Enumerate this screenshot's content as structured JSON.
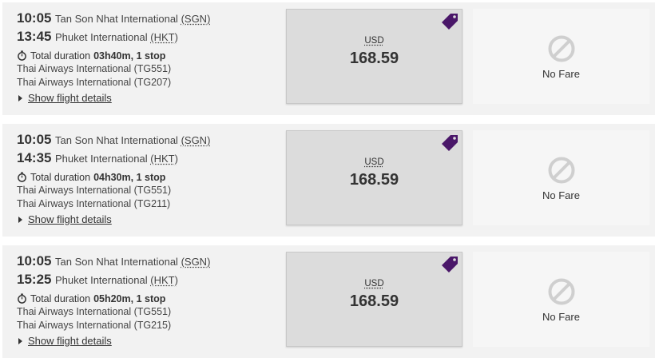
{
  "brand": {
    "accent": "#4a1769",
    "fare_bg": "#dcdcdc",
    "row_bg": "#f2f2f2"
  },
  "flights": [
    {
      "dep_time": "10:05",
      "dep_airport": "Tan Son Nhat International",
      "dep_code": "(SGN)",
      "arr_time": "13:45",
      "arr_airport": "Phuket International",
      "arr_code": "(HKT)",
      "duration_label": "Total duration",
      "duration_value": "03h40m, 1 stop",
      "carriers": [
        "Thai Airways International (TG551)",
        "Thai Airways International (TG207)"
      ],
      "details_label": "Show flight details",
      "fare_currency": "USD",
      "fare_price": "168.59",
      "no_fare_label": "No Fare"
    },
    {
      "dep_time": "10:05",
      "dep_airport": "Tan Son Nhat International",
      "dep_code": "(SGN)",
      "arr_time": "14:35",
      "arr_airport": "Phuket International",
      "arr_code": "(HKT)",
      "duration_label": "Total duration",
      "duration_value": "04h30m, 1 stop",
      "carriers": [
        "Thai Airways International (TG551)",
        "Thai Airways International (TG211)"
      ],
      "details_label": "Show flight details",
      "fare_currency": "USD",
      "fare_price": "168.59",
      "no_fare_label": "No Fare"
    },
    {
      "dep_time": "10:05",
      "dep_airport": "Tan Son Nhat International",
      "dep_code": "(SGN)",
      "arr_time": "15:25",
      "arr_airport": "Phuket International",
      "arr_code": "(HKT)",
      "duration_label": "Total duration",
      "duration_value": "05h20m, 1 stop",
      "carriers": [
        "Thai Airways International (TG551)",
        "Thai Airways International (TG215)"
      ],
      "details_label": "Show flight details",
      "fare_currency": "USD",
      "fare_price": "168.59",
      "no_fare_label": "No Fare"
    }
  ]
}
